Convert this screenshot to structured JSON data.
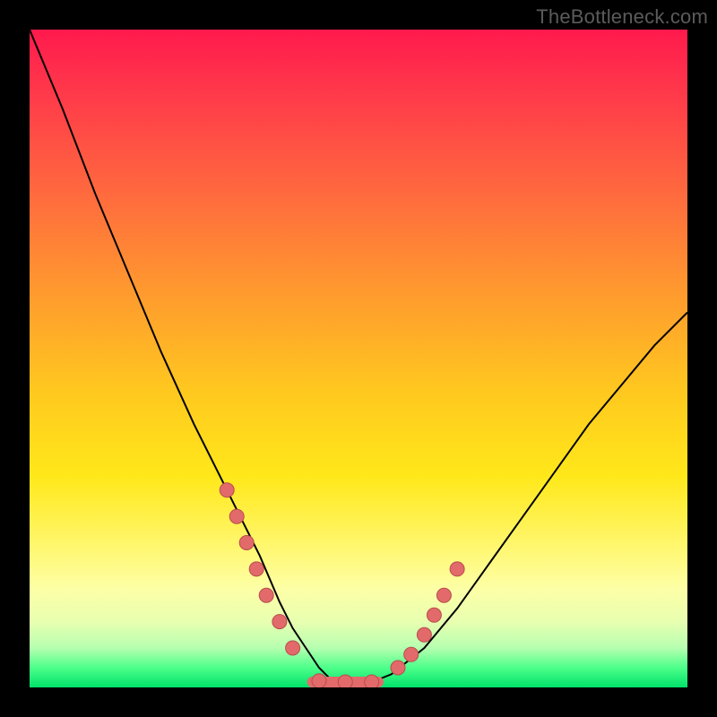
{
  "watermark": "TheBottleneck.com",
  "chart_data": {
    "type": "line",
    "title": "",
    "xlabel": "",
    "ylabel": "",
    "xlim": [
      0,
      100
    ],
    "ylim": [
      0,
      100
    ],
    "grid": false,
    "legend": false,
    "series": [
      {
        "name": "bottleneck-curve",
        "x": [
          0,
          5,
          10,
          15,
          20,
          25,
          30,
          35,
          38,
          40,
          42,
          44,
          46,
          48,
          50,
          55,
          60,
          65,
          70,
          75,
          80,
          85,
          90,
          95,
          100
        ],
        "y": [
          100,
          88,
          75,
          63,
          51,
          40,
          30,
          20,
          13,
          9,
          6,
          3,
          1,
          0,
          0,
          2,
          6,
          12,
          19,
          26,
          33,
          40,
          46,
          52,
          57
        ]
      }
    ],
    "markers": {
      "name": "highlight-dots",
      "x": [
        30,
        31.5,
        33,
        34.5,
        36,
        38,
        40,
        44,
        48,
        52,
        56,
        58,
        60,
        61.5,
        63,
        65
      ],
      "y": [
        30,
        26,
        22,
        18,
        14,
        10,
        6,
        1,
        0,
        0,
        3,
        5,
        8,
        11,
        14,
        18
      ]
    },
    "flat_segment": {
      "x_start": 43,
      "x_end": 53,
      "y": 0
    }
  }
}
